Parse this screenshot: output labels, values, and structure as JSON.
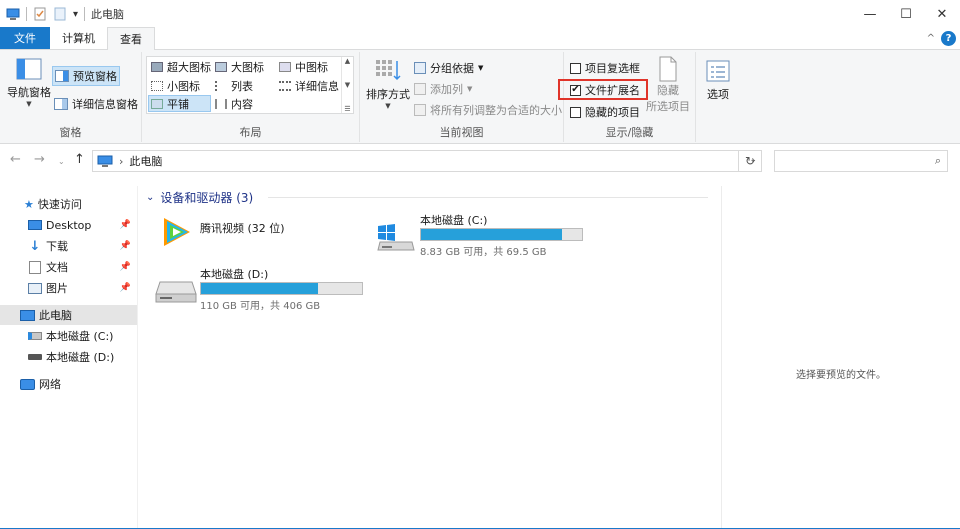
{
  "titlebar": {
    "title": "此电脑",
    "qa_dropdown": "▾",
    "minimize": "—",
    "maximize": "☐",
    "close": "✕"
  },
  "tabs": {
    "file": "文件",
    "computer": "计算机",
    "view": "查看",
    "collapse": "^",
    "help": "?"
  },
  "ribbon": {
    "panes": {
      "nav_pane": "导航窗格",
      "preview_pane": "预览窗格",
      "details_pane": "详细信息窗格",
      "label": "窗格"
    },
    "layout": {
      "extra_large": "超大图标",
      "large": "大图标",
      "medium": "中图标",
      "small": "小图标",
      "list": "列表",
      "details": "详细信息",
      "tiles": "平铺",
      "content": "内容",
      "label": "布局"
    },
    "current_view": {
      "sort_by": "排序方式",
      "group_by": "分组依据",
      "add_columns": "添加列",
      "size_all_columns": "将所有列调整为合适的大小",
      "label": "当前视图"
    },
    "show_hide": {
      "item_checkboxes": "项目复选框",
      "file_extensions": "文件扩展名",
      "file_extensions_checked": "✔",
      "hidden_items": "隐藏的项目",
      "hide_selected_top": "隐藏",
      "hide_selected_bottom": "所选项目",
      "label": "显示/隐藏"
    },
    "options": "选项"
  },
  "address": {
    "separator": "›",
    "path": "此电脑",
    "dropdown": "⌄",
    "refresh": "↻",
    "search_placeholder": ""
  },
  "sidebar": {
    "quick_access": "快速访问",
    "desktop": "Desktop",
    "downloads": "下载",
    "documents": "文档",
    "pictures": "图片",
    "this_pc": "此电脑",
    "local_c": "本地磁盘 (C:)",
    "local_d": "本地磁盘 (D:)",
    "network": "网络"
  },
  "content": {
    "section_title": "设备和驱动器 (3)",
    "tencent": {
      "name": "腾讯视频 (32 位)"
    },
    "drive_c": {
      "name": "本地磁盘 (C:)",
      "info": "8.83 GB 可用，共 69.5 GB",
      "used_fraction": 0.873
    },
    "drive_d": {
      "name": "本地磁盘 (D:)",
      "info": "110 GB 可用，共 406 GB",
      "used_fraction": 0.729
    }
  },
  "preview": {
    "text": "选择要预览的文件。"
  },
  "colors": {
    "accent": "#1979ca",
    "drive_fill": "#26a0da",
    "highlight_box": "#e0342a"
  }
}
